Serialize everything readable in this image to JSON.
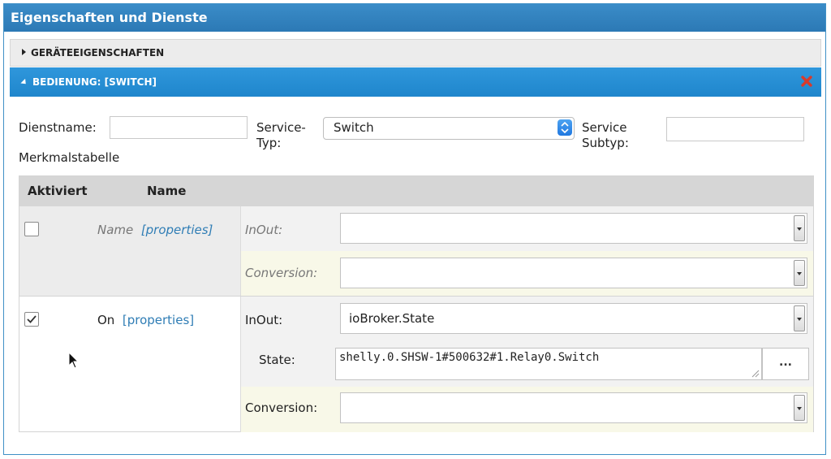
{
  "window": {
    "title": "Eigenschaften und Dienste"
  },
  "accordion": {
    "device_props_label": "GERÄTEEIGENSCHAFTEN",
    "service_label": "BEDIENUNG: [SWITCH]"
  },
  "form": {
    "service_name_label": "Dienstname:",
    "service_name_value": "",
    "service_type_label": "Service-\nTyp:",
    "service_type_value": "Switch",
    "service_subtype_label": "Service\nSubtyp:",
    "service_subtype_value": "",
    "feature_table_label": "Merkmalstabelle"
  },
  "table": {
    "headers": [
      "Aktiviert",
      "Name"
    ],
    "rows": [
      {
        "checked": false,
        "name": "Name",
        "properties_link": "[properties]",
        "inout_label": "InOut:",
        "inout_value": "",
        "conversion_label": "Conversion:",
        "conversion_value": ""
      },
      {
        "checked": true,
        "name": "On",
        "properties_link": "[properties]",
        "inout_label": "InOut:",
        "inout_value": "ioBroker.State",
        "state_label": "State:",
        "state_value": "shelly.0.SHSW-1#500632#1.Relay0.Switch",
        "browse_label": "...",
        "conversion_label": "Conversion:",
        "conversion_value": ""
      }
    ]
  },
  "colors": {
    "title_bar": "#2c79b5",
    "accordion_active": "#1f86cc",
    "link": "#2f7db5",
    "close_icon": "#d93a2b"
  }
}
